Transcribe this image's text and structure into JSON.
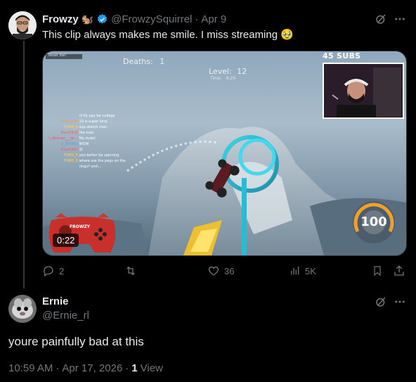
{
  "tweet": {
    "author_name": "Frowzy",
    "author_emoji": "🐿️",
    "handle": "@FrowzySquirrel",
    "separator": "·",
    "date": "Apr 9",
    "text": "This clip always makes me smile. I miss streaming",
    "text_emoji": "🥹",
    "video": {
      "duration": "0:22",
      "deaths_label": "Deaths:",
      "deaths_value": "1",
      "level_label": "Level:",
      "level_value": "12",
      "time_label": "Time:",
      "time_value": "9:20",
      "subs": "45 SUBS",
      "reset_label": "Reset Ball",
      "speed": "100",
      "controller_label": "FROWZY",
      "chat": [
        {
          "user": "",
          "msg": "ill fly pay for college"
        },
        {
          "user": "shiitleight",
          "msg": "13 is super long"
        },
        {
          "user": "FXMD_8",
          "msg": "sup sketch man"
        },
        {
          "user": "illest0420",
          "msg": "the man"
        },
        {
          "user": "t_dbnnao___de...",
          "msg": "My dude!"
        },
        {
          "user": "a_JAYMES",
          "msg": "WOW"
        },
        {
          "user": "illest0420",
          "msg": "😮"
        },
        {
          "user": "FXMD_8",
          "msg": "you better be spinning"
        },
        {
          "user": "FXMD_8",
          "msg": "where are the pegs on the"
        },
        {
          "user": "",
          "msg": "rings? smh..."
        }
      ]
    },
    "actions": {
      "replies": "2",
      "retweets": "",
      "likes": "36",
      "views": "5K"
    }
  },
  "reply": {
    "author_name": "Ernie",
    "handle": "@Ernie_rl",
    "text": "youre painfully bad at this",
    "time": "10:59 AM",
    "separator": "·",
    "date": "Apr 17, 2026",
    "separator2": "·",
    "views_count": "1",
    "views_label": "View"
  },
  "colors": {
    "background": "#000000",
    "text": "#e7e9ea",
    "muted": "#71767b",
    "verified": "#1d9bf0",
    "divider": "#2f3336"
  }
}
